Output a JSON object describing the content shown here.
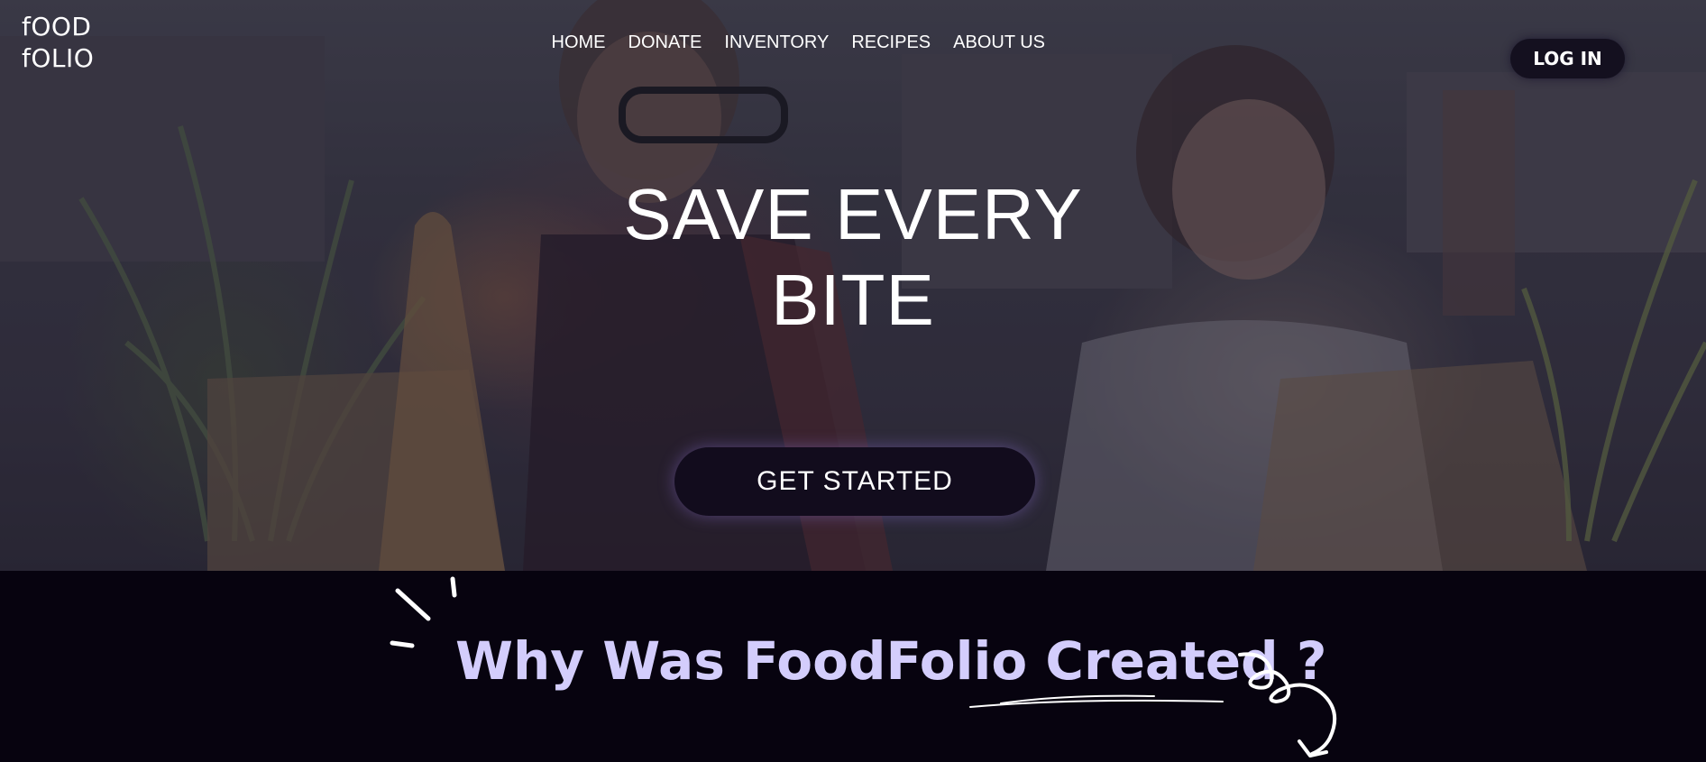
{
  "logo": {
    "line1": "fOOD",
    "line2": "fOLIO"
  },
  "nav": {
    "items": [
      {
        "label": "HOME"
      },
      {
        "label": "DONATE"
      },
      {
        "label": "INVENTORY"
      },
      {
        "label": "RECIPES"
      },
      {
        "label": "ABOUT US"
      }
    ]
  },
  "header": {
    "login_label": "LOG IN"
  },
  "hero": {
    "title_line1": "SAVE EVERY",
    "title_line2": "BITE",
    "cta_label": "GET STARTED"
  },
  "why_section": {
    "heading": "Why Was FoodFolio Created ?"
  },
  "colors": {
    "heading_accent": "#d3cdfc",
    "dark_bg": "#07030f",
    "button_bg": "#14101f",
    "text": "#ffffff"
  }
}
